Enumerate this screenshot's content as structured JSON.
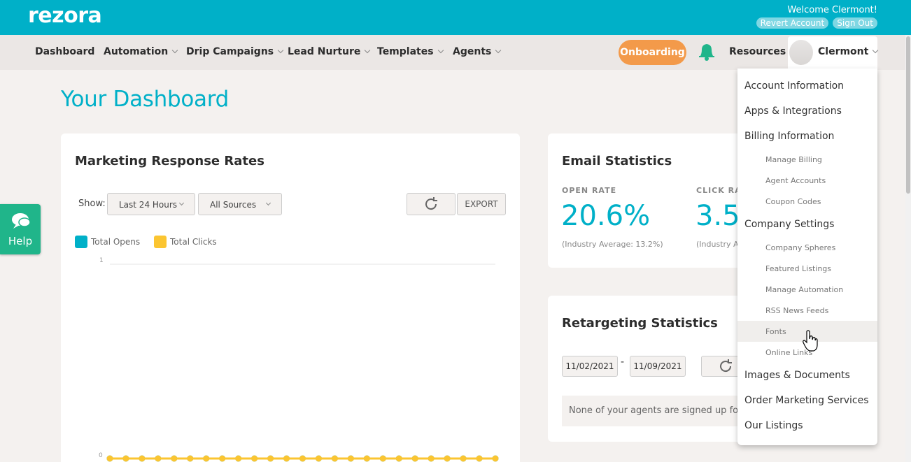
{
  "app": {
    "logo": "rezora"
  },
  "account": {
    "welcome": "Welcome Clermont!",
    "revert_label": "Revert Account",
    "signout_label": "Sign Out"
  },
  "nav": {
    "items": [
      {
        "label": "Dashboard"
      },
      {
        "label": "Automation"
      },
      {
        "label": "Drip Campaigns"
      },
      {
        "label": "Lead Nurture"
      },
      {
        "label": "Templates"
      },
      {
        "label": "Agents"
      }
    ],
    "onboarding": "Onboarding",
    "resources": "Resources",
    "user": "Clermont",
    "bell_icon": "bell-icon",
    "accent_color": "#00b0c8"
  },
  "page": {
    "title": "Your Dashboard"
  },
  "help": {
    "label": "Help",
    "icon": "chat-icon"
  },
  "marketing": {
    "title": "Marketing Response Rates",
    "show_label": "Show:",
    "time_select": "Last 24 Hours",
    "source_select": "All Sources",
    "export_label": "EXPORT",
    "legend": [
      {
        "label": "Total Opens",
        "color": "#00b0c8"
      },
      {
        "label": "Total Clicks",
        "color": "#fbc531"
      }
    ],
    "y_top": "1",
    "y_bottom": "0"
  },
  "chart_data": {
    "type": "line",
    "title": "",
    "xlabel": "",
    "ylabel": "",
    "ylim": [
      0,
      1
    ],
    "x": [
      1,
      2,
      3,
      4,
      5,
      6,
      7,
      8,
      9,
      10,
      11,
      12,
      13,
      14,
      15,
      16,
      17,
      18,
      19,
      20,
      21,
      22,
      23,
      24,
      25
    ],
    "series": [
      {
        "name": "Total Opens",
        "values": [
          0,
          0,
          0,
          0,
          0,
          0,
          0,
          0,
          0,
          0,
          0,
          0,
          0,
          0,
          0,
          0,
          0,
          0,
          0,
          0,
          0,
          0,
          0,
          0,
          0
        ]
      },
      {
        "name": "Total Clicks",
        "values": [
          0,
          0,
          0,
          0,
          0,
          0,
          0,
          0,
          0,
          0,
          0,
          0,
          0,
          0,
          0,
          0,
          0,
          0,
          0,
          0,
          0,
          0,
          0,
          0,
          0
        ]
      }
    ],
    "grid": true,
    "legend": "top-left"
  },
  "email_stats": {
    "title": "Email Statistics",
    "open_rate_label": "OPEN RATE",
    "open_rate_value": "20.6%",
    "open_rate_sub": "(Industry Average: 13.2%)",
    "click_rate_label": "CLICK RAT",
    "click_rate_value": "3.5",
    "click_rate_sub": "(Industry A"
  },
  "retargeting": {
    "title": "Retargeting Statistics",
    "date_from": "11/02/2021",
    "date_sep": "-",
    "date_to": "11/09/2021",
    "notice": "None of your agents are signed up for reta"
  },
  "dropdown": {
    "account_information": "Account Information",
    "apps_integrations": "Apps & Integrations",
    "billing_information": "Billing Information",
    "manage_billing": "Manage Billing",
    "agent_accounts": "Agent Accounts",
    "coupon_codes": "Coupon Codes",
    "company_settings": "Company Settings",
    "company_spheres": "Company Spheres",
    "featured_listings": "Featured Listings",
    "manage_automation": "Manage Automation",
    "rss_news_feeds": "RSS News Feeds",
    "fonts": "Fonts",
    "online_links": "Online Links",
    "images_documents": "Images & Documents",
    "order_marketing_services": "Order Marketing Services",
    "our_listings": "Our Listings"
  }
}
